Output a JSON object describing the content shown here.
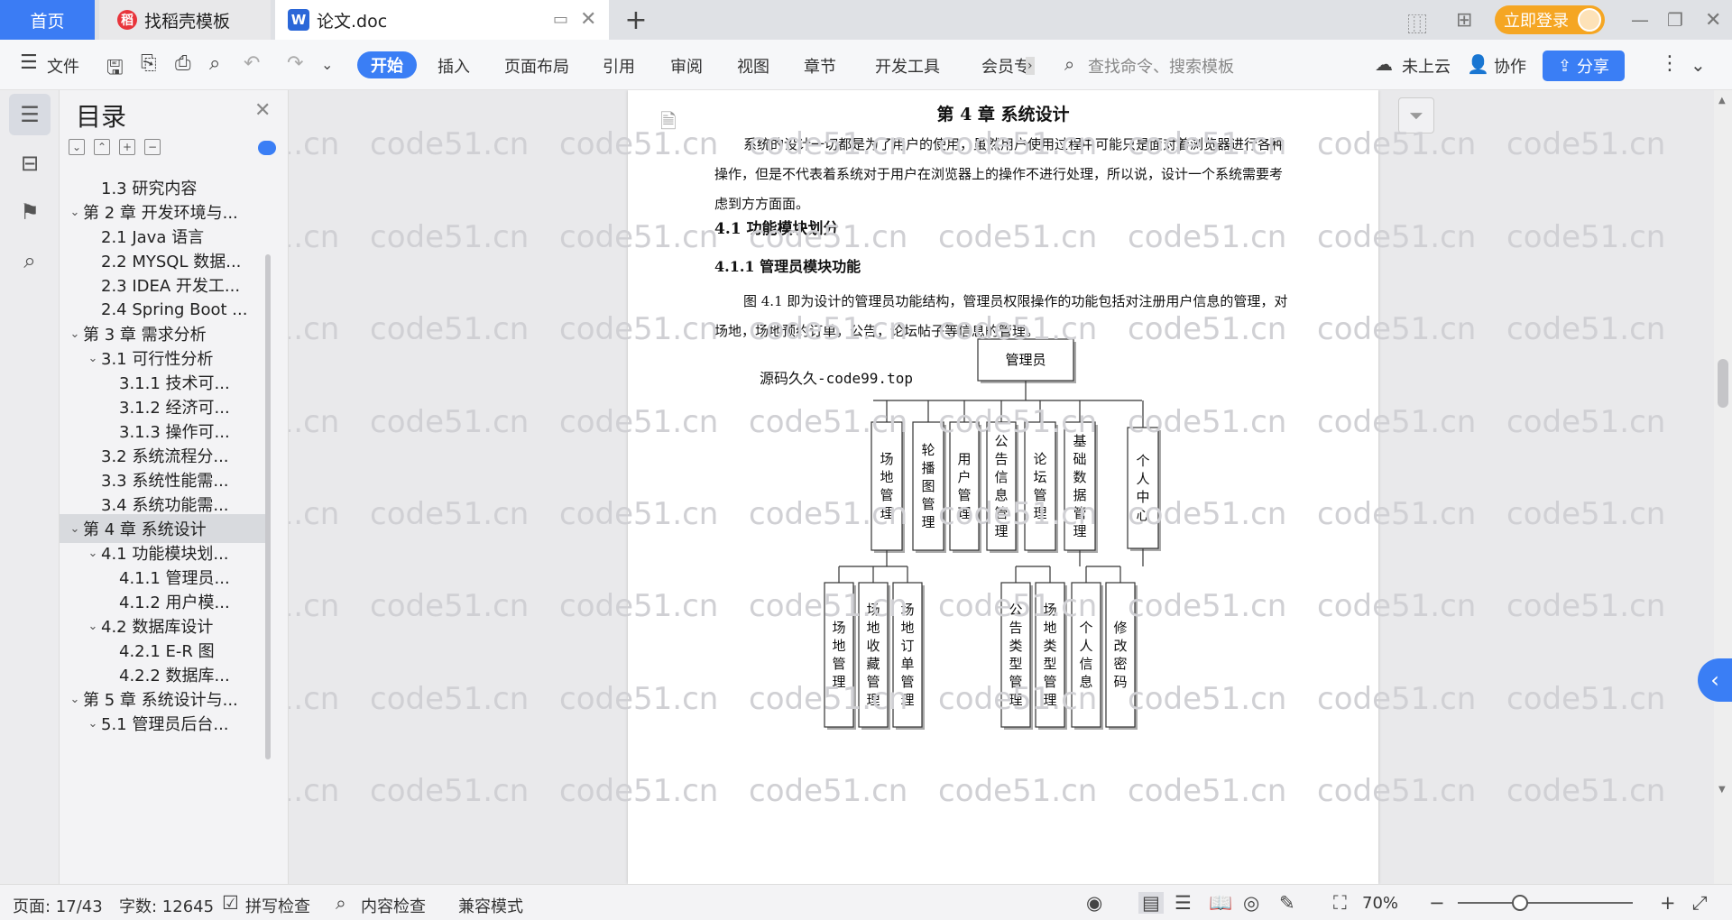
{
  "tabs": {
    "home": "首页",
    "template": "找稻壳模板",
    "doc": "论文.doc",
    "template_icon": "稻",
    "doc_icon": "W"
  },
  "topright": {
    "login": "立即登录"
  },
  "toolbar": {
    "file": "文件",
    "menus": [
      "开始",
      "插入",
      "页面布局",
      "引用",
      "审阅",
      "视图",
      "章节",
      "开发工具",
      "会员专"
    ],
    "search_placeholder": "查找命令、搜索模板",
    "cloud": "未上云",
    "collab": "协作",
    "share": "分享"
  },
  "toc": {
    "title": "目录",
    "items": [
      {
        "text": "1.3  研究内容",
        "level": 2,
        "expanded": null
      },
      {
        "text": "第 2 章  开发环境与...",
        "level": 1,
        "expanded": true
      },
      {
        "text": "2.1 Java 语言",
        "level": 2,
        "expanded": null
      },
      {
        "text": "2.2 MYSQL 数据...",
        "level": 2,
        "expanded": null
      },
      {
        "text": "2.3 IDEA 开发工...",
        "level": 2,
        "expanded": null
      },
      {
        "text": "2.4 Spring Boot ...",
        "level": 2,
        "expanded": null
      },
      {
        "text": "第 3 章  需求分析",
        "level": 1,
        "expanded": true
      },
      {
        "text": "3.1  可行性分析",
        "level": 2,
        "expanded": true
      },
      {
        "text": "3.1.1  技术可...",
        "level": 3,
        "expanded": null
      },
      {
        "text": "3.1.2  经济可...",
        "level": 3,
        "expanded": null
      },
      {
        "text": "3.1.3  操作可...",
        "level": 3,
        "expanded": null
      },
      {
        "text": "3.2  系统流程分...",
        "level": 2,
        "expanded": null
      },
      {
        "text": "3.3  系统性能需...",
        "level": 2,
        "expanded": null
      },
      {
        "text": "3.4  系统功能需...",
        "level": 2,
        "expanded": null
      },
      {
        "text": "第 4 章  系统设计",
        "level": 1,
        "expanded": true,
        "selected": true
      },
      {
        "text": "4.1  功能模块划...",
        "level": 2,
        "expanded": true
      },
      {
        "text": "4.1.1  管理员...",
        "level": 3,
        "expanded": null
      },
      {
        "text": "4.1.2  用户模...",
        "level": 3,
        "expanded": null
      },
      {
        "text": "4.2  数据库设计",
        "level": 2,
        "expanded": true
      },
      {
        "text": "4.2.1 E-R 图",
        "level": 3,
        "expanded": null
      },
      {
        "text": "4.2.2  数据库...",
        "level": 3,
        "expanded": null
      },
      {
        "text": "第 5 章  系统设计与...",
        "level": 1,
        "expanded": true
      },
      {
        "text": "5.1  管理员后台...",
        "level": 2,
        "expanded": true
      }
    ]
  },
  "document": {
    "chapter_title": "第 4 章  系统设计",
    "para1": "系统的设计一切都是为了用户的使用，虽然用户使用过程中可能只是面对着浏览器进行各种操作，但是不代表着系统对于用户在浏览器上的操作不进行处理，所以说，设计一个系统需要考虑到方方面面。",
    "h2": "4.1  功能模块划分",
    "h3": "4.1.1  管理员模块功能",
    "para2": "图 4.1 即为设计的管理员功能结构，管理员权限操作的功能包括对注册用户信息的管理，对场地，场地预约订单，公告，论坛帖子等信息的管理。",
    "diagram_root": "管理员",
    "diagram_level1": [
      "场地管理",
      "轮播图管理",
      "用户管理",
      "公告信息管理",
      "论坛管理",
      "基础数据管理",
      "个人中心"
    ],
    "diagram_children_venue": [
      "场地管理",
      "场地收藏管理",
      "场地订单管理"
    ],
    "diagram_children_basic": [
      "公告类型管理",
      "场地类型管理"
    ],
    "diagram_children_personal": [
      "个人信息",
      "修改密码"
    ],
    "source_note": "源码久久-code99.top"
  },
  "watermark": "code51.cn",
  "status": {
    "page": "页面: 17/43",
    "words": "字数: 12645",
    "spell": "拼写检查",
    "content": "内容检查",
    "compat": "兼容模式",
    "zoom": "70%"
  },
  "colors": {
    "accent": "#3a7ef5",
    "home_tab": "#3b7cf4",
    "login": "#f5a623"
  }
}
